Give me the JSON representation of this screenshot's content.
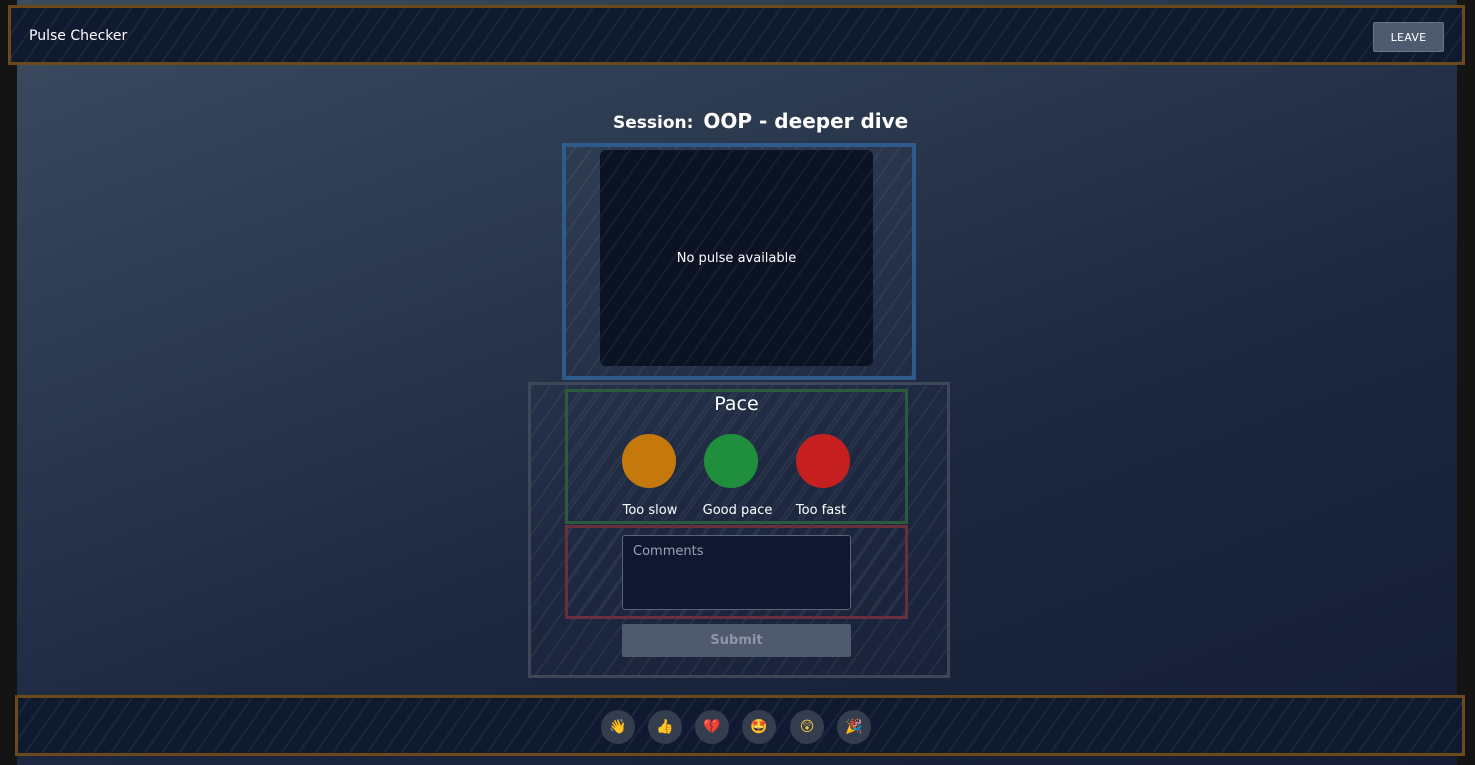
{
  "header": {
    "app_title": "Pulse Checker",
    "leave_label": "LEAVE"
  },
  "session": {
    "label": "Session:",
    "name": "OOP - deeper dive"
  },
  "pulse": {
    "empty_text": "No pulse available"
  },
  "pace": {
    "title": "Pace",
    "options": [
      {
        "label": "Too slow",
        "color": "#c5780c"
      },
      {
        "label": "Good pace",
        "color": "#1f8f3e"
      },
      {
        "label": "Too fast",
        "color": "#c61f1f"
      }
    ]
  },
  "comments": {
    "placeholder": "Comments"
  },
  "submit": {
    "label": "Submit"
  },
  "reactions": [
    {
      "icon": "waving-hand-icon",
      "glyph": "👋"
    },
    {
      "icon": "thumbs-up-icon",
      "glyph": "👍"
    },
    {
      "icon": "broken-heart-icon",
      "glyph": "💔"
    },
    {
      "icon": "star-struck-icon",
      "glyph": "🤩"
    },
    {
      "icon": "astonished-face-icon",
      "glyph": "😲"
    },
    {
      "icon": "party-popper-icon",
      "glyph": "🎉"
    }
  ]
}
